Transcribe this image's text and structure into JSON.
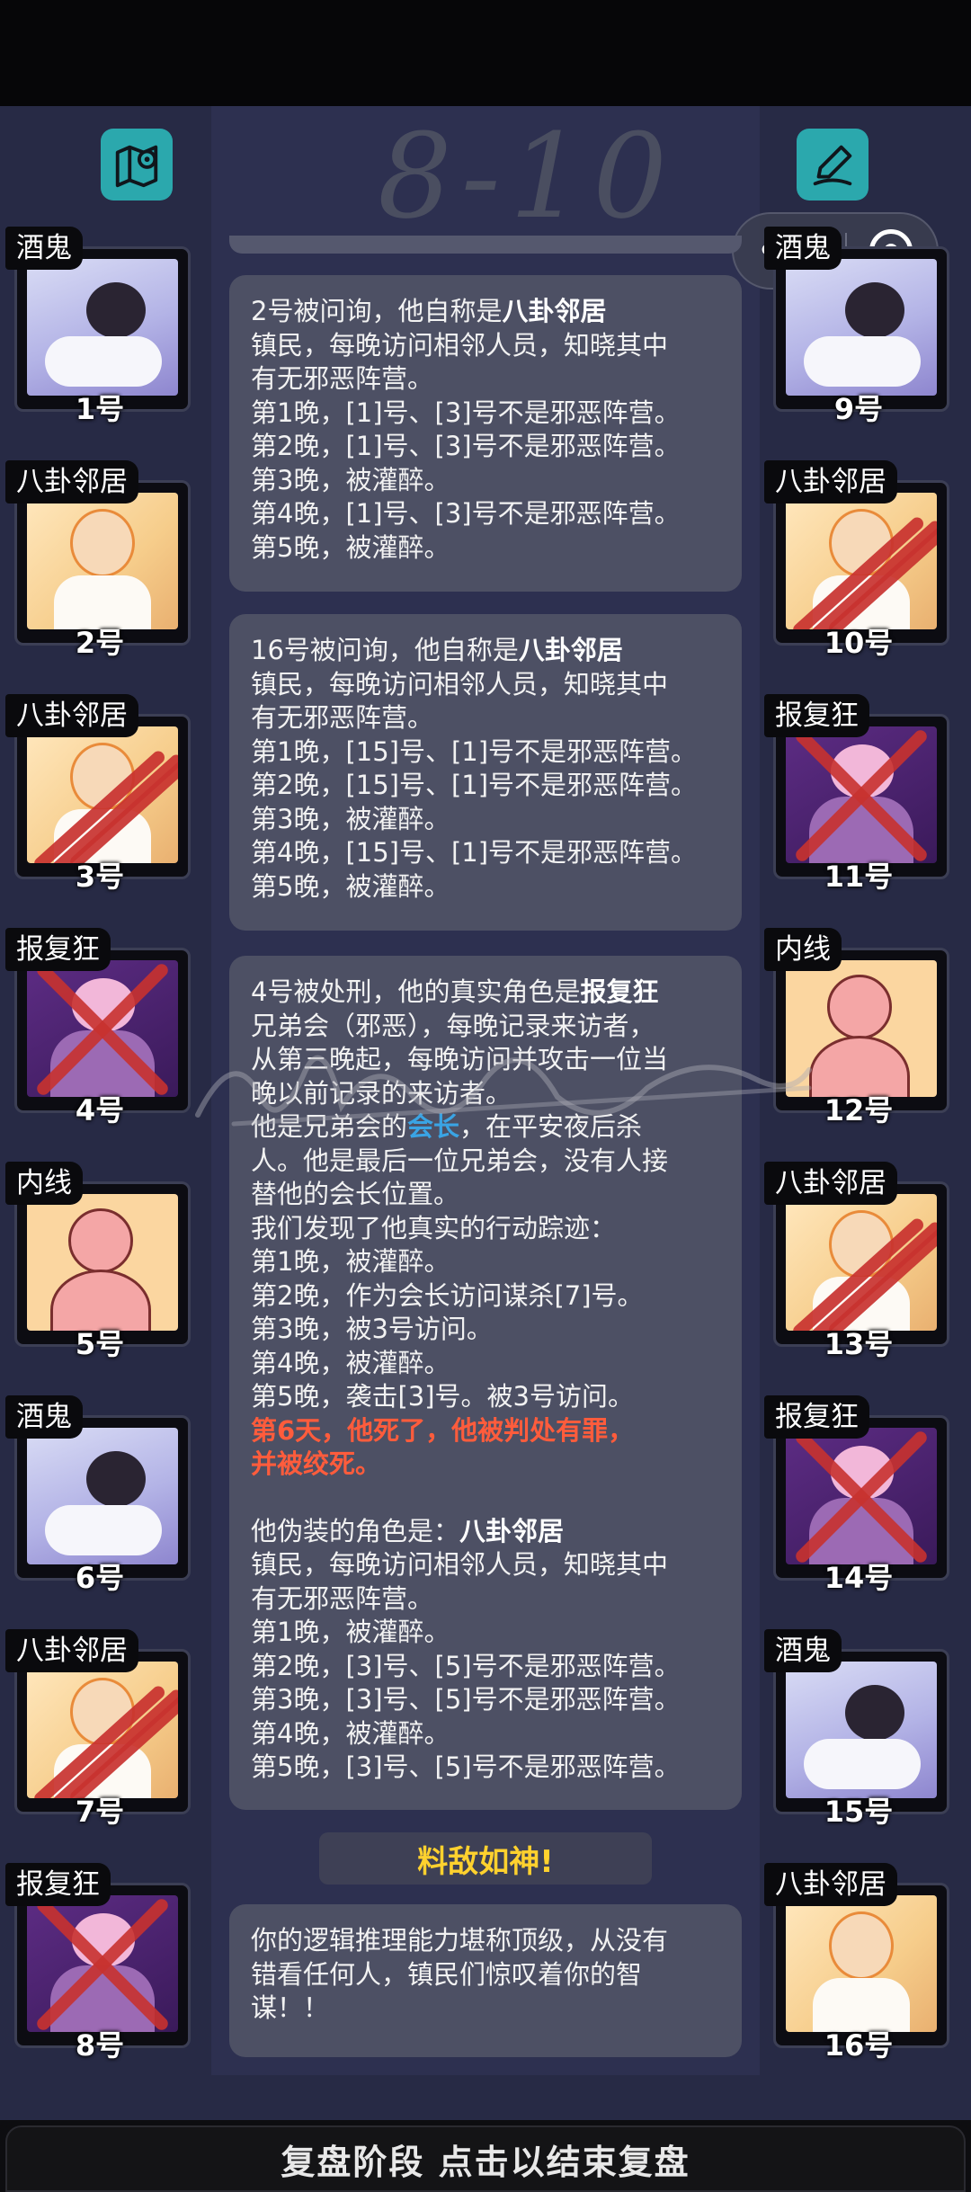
{
  "header": {
    "handwritten_note": "8-10",
    "left_icon": "map-pin-icon",
    "right_icon": "pen-edit-icon"
  },
  "capsule": {
    "more_label": "•••",
    "close_icon": "target-icon"
  },
  "players": [
    {
      "number": "1号",
      "role": "酒鬼",
      "art": "drunk",
      "marked": "none"
    },
    {
      "number": "2号",
      "role": "八卦邻居",
      "art": "gossip",
      "marked": "none"
    },
    {
      "number": "3号",
      "role": "八卦邻居",
      "art": "gossip",
      "marked": "slash"
    },
    {
      "number": "4号",
      "role": "报复狂",
      "art": "avenger",
      "marked": "cross"
    },
    {
      "number": "5号",
      "role": "内线",
      "art": "spy",
      "marked": "none"
    },
    {
      "number": "6号",
      "role": "酒鬼",
      "art": "drunk",
      "marked": "none"
    },
    {
      "number": "7号",
      "role": "八卦邻居",
      "art": "gossip",
      "marked": "slash"
    },
    {
      "number": "8号",
      "role": "报复狂",
      "art": "avenger",
      "marked": "cross"
    },
    {
      "number": "9号",
      "role": "酒鬼",
      "art": "drunk",
      "marked": "none"
    },
    {
      "number": "10号",
      "role": "八卦邻居",
      "art": "gossip",
      "marked": "slash"
    },
    {
      "number": "11号",
      "role": "报复狂",
      "art": "avenger",
      "marked": "cross"
    },
    {
      "number": "12号",
      "role": "内线",
      "art": "spy",
      "marked": "none"
    },
    {
      "number": "13号",
      "role": "八卦邻居",
      "art": "gossip",
      "marked": "slash"
    },
    {
      "number": "14号",
      "role": "报复狂",
      "art": "avenger",
      "marked": "cross"
    },
    {
      "number": "15号",
      "role": "酒鬼",
      "art": "drunk",
      "marked": "none"
    },
    {
      "number": "16号",
      "role": "八卦邻居",
      "art": "gossip",
      "marked": "none"
    }
  ],
  "messages": {
    "m1": {
      "intro": "2号被问询，他自称是",
      "role": "八卦邻居",
      "lines": [
        "镇民，每晚访问相邻人员，知晓其中",
        "有无邪恶阵营。",
        "第1晚，[1]号、[3]号不是邪恶阵营。",
        "第2晚，[1]号、[3]号不是邪恶阵营。",
        "第3晚，被灌醉。",
        "第4晚，[1]号、[3]号不是邪恶阵营。",
        "第5晚，被灌醉。"
      ]
    },
    "m2": {
      "intro": "16号被问询，他自称是",
      "role": "八卦邻居",
      "lines": [
        "镇民，每晚访问相邻人员，知晓其中",
        "有无邪恶阵营。",
        "第1晚，[15]号、[1]号不是邪恶阵营。",
        "第2晚，[15]号、[1]号不是邪恶阵营。",
        "第3晚，被灌醉。",
        "第4晚，[15]号、[1]号不是邪恶阵营。",
        "第5晚，被灌醉。"
      ]
    },
    "m3": {
      "intro": "4号被处刑，他的真实角色是",
      "role": "报复狂",
      "lines_a": [
        "兄弟会（邪恶），每晚记录来访者，",
        "从第三晚起，每晚访问并攻击一位当",
        "晚以前记录的来访者。"
      ],
      "line_mid_pre": "他是兄弟会的",
      "line_mid_link": "会长",
      "line_mid_post": "，在平安夜后杀",
      "lines_b": [
        "人。他是最后一位兄弟会，没有人接",
        "替他的会长位置。",
        "我们发现了他真实的行动踪迹：",
        "第1晚，被灌醉。",
        "第2晚，作为会长访问谋杀[7]号。",
        "第3晚，被3号访问。",
        "第4晚，被灌醉。",
        "第5晚，袭击[3]号。被3号访问。"
      ],
      "verdict_1": "第6天，他死了，他被判处有罪，",
      "verdict_2": "并被绞死。",
      "disguise_intro": "他伪装的角色是：",
      "disguise_role": "八卦邻居",
      "lines_c": [
        "镇民，每晚访问相邻人员，知晓其中",
        "有无邪恶阵营。",
        "第1晚，被灌醉。",
        "第2晚，[3]号、[5]号不是邪恶阵营。",
        "第3晚，[3]号、[5]号不是邪恶阵营。",
        "第4晚，被灌醉。",
        "第5晚，[3]号、[5]号不是邪恶阵营。"
      ]
    },
    "banner": "料敌如神!",
    "m4": {
      "lines": [
        "你的逻辑推理能力堪称顶级，从没有",
        "错看任何人，镇民们惊叹着你的智",
        "谋！！"
      ]
    }
  },
  "footer": {
    "label": "复盘阶段 点击以结束复盘"
  },
  "colors": {
    "accent": "#2ba8ad",
    "highlight_red": "#ff5c3c",
    "banner_gold": "#ffd12e",
    "link_blue": "#3aa4e4"
  }
}
